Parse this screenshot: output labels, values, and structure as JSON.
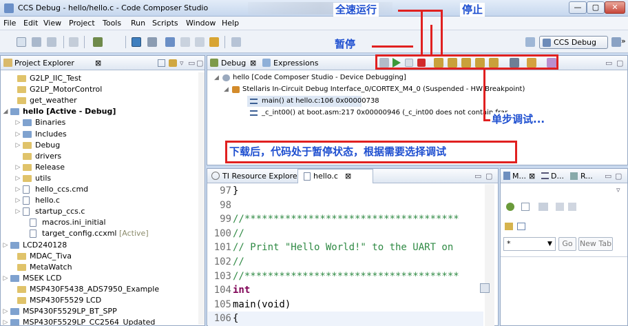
{
  "window": {
    "title": "CCS Debug - hello/hello.c - Code Composer Studio",
    "min_glyph": "—",
    "max_glyph": "▢",
    "close_glyph": "✕"
  },
  "menu": [
    "File",
    "Edit",
    "View",
    "Project",
    "Tools",
    "Run",
    "Scripts",
    "Window",
    "Help"
  ],
  "toolbar": {
    "perspective_label": "CCS Debug",
    "more_glyph": "»"
  },
  "project_explorer": {
    "tab_label": "Project Explorer",
    "tab_close": "⊠",
    "items": [
      {
        "label": "G2LP_IIC_Test",
        "suffix": ""
      },
      {
        "label": "G2LP_MotorControl",
        "suffix": ""
      },
      {
        "label": "get_weather",
        "suffix": ""
      },
      {
        "label": "hello  [Active - Debug]",
        "suffix": ""
      },
      {
        "label": "Binaries",
        "suffix": ""
      },
      {
        "label": "Includes",
        "suffix": ""
      },
      {
        "label": "Debug",
        "suffix": ""
      },
      {
        "label": "drivers",
        "suffix": ""
      },
      {
        "label": "Release",
        "suffix": ""
      },
      {
        "label": "utils",
        "suffix": ""
      },
      {
        "label": "hello_ccs.cmd",
        "suffix": ""
      },
      {
        "label": "hello.c",
        "suffix": ""
      },
      {
        "label": "startup_ccs.c",
        "suffix": ""
      },
      {
        "label": "macros.ini_initial",
        "suffix": ""
      },
      {
        "label": "target_config.ccxml",
        "suffix": "[Active]"
      },
      {
        "label": "LCD240128",
        "suffix": ""
      },
      {
        "label": "MDAC_Tiva",
        "suffix": ""
      },
      {
        "label": "MetaWatch",
        "suffix": ""
      },
      {
        "label": "MSEK LCD",
        "suffix": ""
      },
      {
        "label": "MSP430F5438_ADS7950_Example",
        "suffix": ""
      },
      {
        "label": "MSP430F5529 LCD",
        "suffix": ""
      },
      {
        "label": "MSP430F5529LP_BT_SPP",
        "suffix": ""
      },
      {
        "label": "MSP430F5529LP_CC2564_Updated",
        "suffix": ""
      }
    ]
  },
  "debug_view": {
    "tab_debug": "Debug",
    "tab_close": "⊠",
    "tab_expressions": "Expressions",
    "rows": [
      "hello [Code Composer Studio - Device Debugging]",
      "Stellaris In-Circuit Debug Interface_0/CORTEX_M4_0 (Suspended - HW Breakpoint)",
      "main() at hello.c:106 0x00000738",
      "_c_int00() at boot.asm:217 0x00000946  (_c_int00 does not contain frar"
    ]
  },
  "editor": {
    "tab_resource": "TI Resource Explorer",
    "tab_file": "hello.c",
    "tab_close": "⊠",
    "lines": [
      {
        "num": "97",
        "text": "}"
      },
      {
        "num": "98",
        "text": ""
      },
      {
        "num": "99",
        "text": "//*************************************"
      },
      {
        "num": "100",
        "text": "//"
      },
      {
        "num": "101",
        "text": "// Print \"Hello World!\" to the UART on"
      },
      {
        "num": "102",
        "text": "//"
      },
      {
        "num": "103",
        "text": "//*************************************"
      },
      {
        "num": "104",
        "text": "int"
      },
      {
        "num": "105",
        "text": "main(void)"
      },
      {
        "num": "106",
        "text": "{"
      }
    ]
  },
  "right_panel": {
    "tab_m": "M...",
    "tab_d": "D...",
    "tab_r": "R...",
    "tab_close": "⊠",
    "go_label": "Go",
    "new_tab_label": "New Tab",
    "select_value": "*"
  },
  "annotations": {
    "run": "全速运行",
    "stop": "停止",
    "pause": "暂停",
    "step": "单步调试...",
    "note": "下载后，代码处于暂停状态，根据需要选择调试"
  },
  "colors": {
    "annotation_red": "#e02020",
    "annotation_text": "#1e4fd0"
  }
}
